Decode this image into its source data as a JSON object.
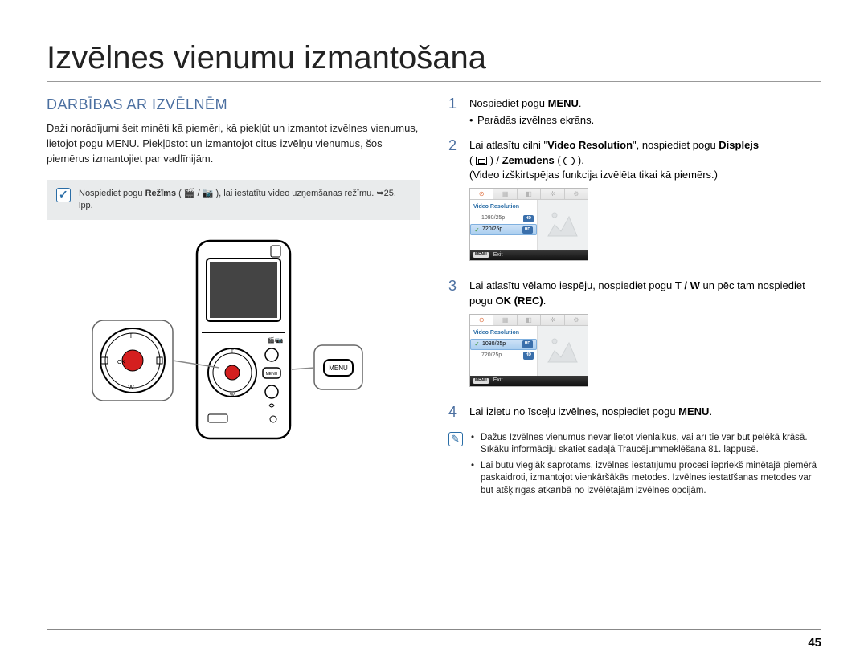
{
  "page_title": "Izvēlnes vienumu izmantošana",
  "section_title": "DARBĪBAS AR IZVĒLNĒM",
  "intro_paragraph": "Daži norādījumi šeit minēti kā piemēri, kā piekļūt un izmantot izvēlnes vienumus, lietojot pogu MENU. Piekļūstot un izmantojot citus izvēlņu vienumus, šos piemērus izmantojiet par vadlīnijām.",
  "mode_note_prefix": "Nospiediet pogu ",
  "mode_note_mode": "Režīms",
  "mode_note_suffix": " ( 🎬 / 📷 ), lai iestatītu video uzņemšanas režīmu. ➥25. lpp.",
  "steps": [
    {
      "num": "1",
      "text_pre": "Nospiediet pogu ",
      "bold1": "MENU",
      "text_post": ".",
      "sub": "Parādās izvēlnes ekrāns."
    },
    {
      "num": "2",
      "line1_a": "Lai atlasītu cilni \"",
      "line1_bold1": "Video Resolution",
      "line1_b": "\", nospiediet pogu ",
      "line1_bold2": "Displejs",
      "line2_a": " ( ",
      "line2_b": " ) / ",
      "line2_bold3": "Zemūdens",
      "line2_c": " ( ",
      "line2_d": " ).",
      "line3": "(Video izšķirtspējas funkcija izvēlēta tikai kā piemērs.)"
    },
    {
      "num": "3",
      "text_a": "Lai atlasītu vēlamo iespēju, nospiediet pogu ",
      "bold1": "T / W",
      "text_b": " un pēc tam nospiediet pogu ",
      "bold2": "OK (REC)",
      "text_c": "."
    },
    {
      "num": "4",
      "text_a": "Lai izietu no īsceļu izvēlnes, nospiediet pogu ",
      "bold1": "MENU",
      "text_b": "."
    }
  ],
  "lcd": {
    "heading": "Video Resolution",
    "row1": "1080/25p",
    "row2": "720/25p",
    "hd": "HD",
    "menu": "MENU",
    "exit": "Exit"
  },
  "info_bullets": [
    "Dažus Izvēlnes vienumus nevar lietot vienlaikus, vai arī tie var būt pelēkā krāsā. Sīkāku informāciju skatiet sadaļā Traucējummeklēšana 81. lappusē.",
    "Lai būtu vieglāk saprotams, izvēlnes iestatījumu procesi iepriekš minētajā piemērā paskaidroti, izmantojot vienkāršākās metodes. Izvēlnes iestatīšanas metodes var būt atšķirīgas atkarībā no izvēlētajām izvēlnes opcijām."
  ],
  "page_number": "45"
}
